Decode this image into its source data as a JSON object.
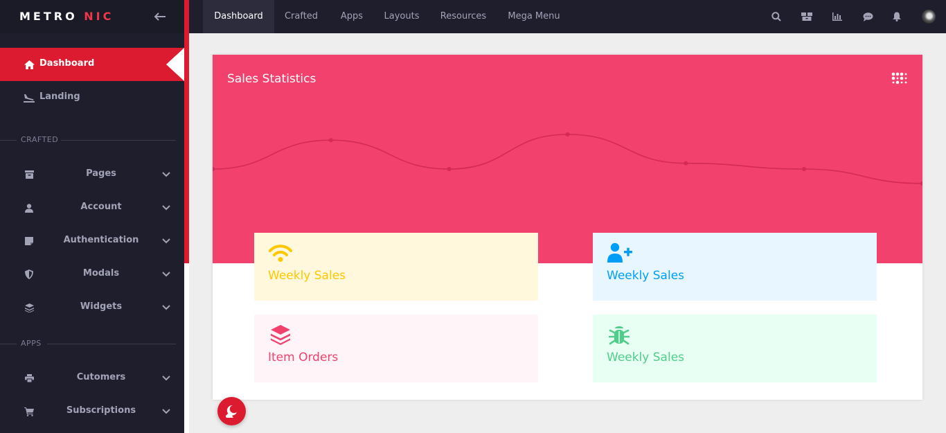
{
  "brand": {
    "logo_a": "METRO",
    "logo_b": "NIC"
  },
  "sidebar": {
    "top_items": [
      {
        "label": "Dashboard",
        "icon": "home-icon",
        "active": true
      },
      {
        "label": "Landing",
        "icon": "plane-landing-icon",
        "active": false
      }
    ],
    "sections": [
      {
        "title": "CRAFTED",
        "items": [
          {
            "label": "Pages",
            "icon": "archive-icon"
          },
          {
            "label": "Account",
            "icon": "user-icon"
          },
          {
            "label": "Authentication",
            "icon": "sticky-note-icon"
          },
          {
            "label": "Modals",
            "icon": "shield-icon"
          },
          {
            "label": "Widgets",
            "icon": "layers-icon"
          }
        ]
      },
      {
        "title": "APPS",
        "items": [
          {
            "label": "Cutomers",
            "icon": "printer-icon"
          },
          {
            "label": "Subscriptions",
            "icon": "shopping-cart-icon"
          }
        ]
      }
    ]
  },
  "topnav": {
    "items": [
      {
        "label": "Dashboard",
        "active": true
      },
      {
        "label": "Crafted",
        "active": false
      },
      {
        "label": "Apps",
        "active": false
      },
      {
        "label": "Layouts",
        "active": false
      },
      {
        "label": "Resources",
        "active": false
      },
      {
        "label": "Mega Menu",
        "active": false
      }
    ],
    "icons": [
      "search-icon",
      "boxes-icon",
      "bar-chart-icon",
      "chat-icon",
      "bell-icon",
      "avatar"
    ]
  },
  "card": {
    "title": "Sales Statistics",
    "hero_color": "#f1416c",
    "tiles": [
      {
        "label": "Weekly Sales",
        "icon": "wifi-icon",
        "bg": "#fff8dd",
        "color": "#ffc700"
      },
      {
        "label": "Weekly Sales",
        "icon": "user-plus-icon",
        "bg": "#e8f6ff",
        "color": "#009ef7"
      },
      {
        "label": "Item Orders",
        "icon": "layers-icon",
        "bg": "#fff5f8",
        "color": "#f1416c"
      },
      {
        "label": "Weekly Sales",
        "icon": "bug-icon",
        "bg": "#e8fff3",
        "color": "#50cd89"
      }
    ]
  },
  "chart_data": {
    "type": "line",
    "series": [
      {
        "values": [
          30,
          40,
          30,
          42,
          32,
          30,
          25
        ]
      }
    ],
    "ylim": [
      0,
      60
    ],
    "grid": false
  },
  "colors": {
    "accent": "#dc1b31",
    "sidebar_bg": "#1e1e2d",
    "page_bg": "#eeeeee"
  },
  "fab": {
    "icon": "moon-cloud-icon"
  }
}
